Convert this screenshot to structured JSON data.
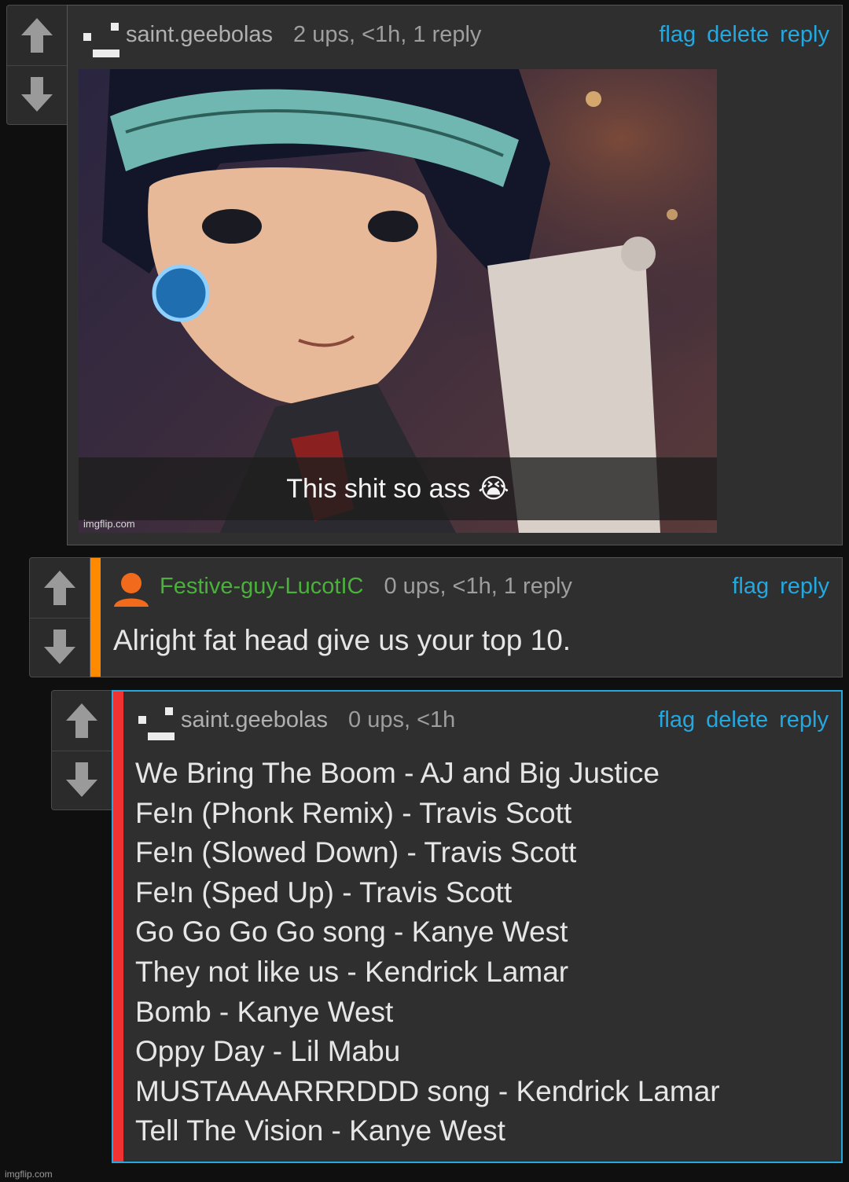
{
  "comments": [
    {
      "username": "saint.geebolas",
      "stats": "2 ups, <1h, 1 reply",
      "actions": [
        "flag",
        "delete",
        "reply"
      ],
      "meme": {
        "caption": "This shit so ass",
        "caption_emoji": "😭",
        "watermark": "imgflip.com"
      }
    },
    {
      "username": "Festive-guy-LucotIC",
      "username_color": "#4bb03c",
      "stripe_color": "#ff8a00",
      "stats": "0 ups, <1h, 1 reply",
      "actions": [
        "flag",
        "reply"
      ],
      "text": "Alright fat head give us your top 10."
    },
    {
      "username": "saint.geebolas",
      "stripe_color": "#f03232",
      "highlight_color": "#24a8e0",
      "stats": "0 ups, <1h",
      "actions": [
        "flag",
        "delete",
        "reply"
      ],
      "lines": [
        "We Bring The Boom - AJ and Big Justice",
        "Fe!n (Phonk Remix) - Travis Scott",
        "Fe!n (Slowed Down) - Travis Scott",
        "Fe!n (Sped Up) - Travis Scott",
        "Go Go Go Go song - Kanye West",
        "They not like us - Kendrick Lamar",
        "Bomb - Kanye West",
        "Oppy Day - Lil Mabu",
        "MUSTAAAARRRDDD song - Kendrick Lamar",
        "Tell The Vision - Kanye West"
      ]
    }
  ],
  "icons": {
    "upvote": "arrow-up-icon",
    "downvote": "arrow-down-icon",
    "user": "user-avatar-icon"
  },
  "page_watermark": "imgflip.com"
}
